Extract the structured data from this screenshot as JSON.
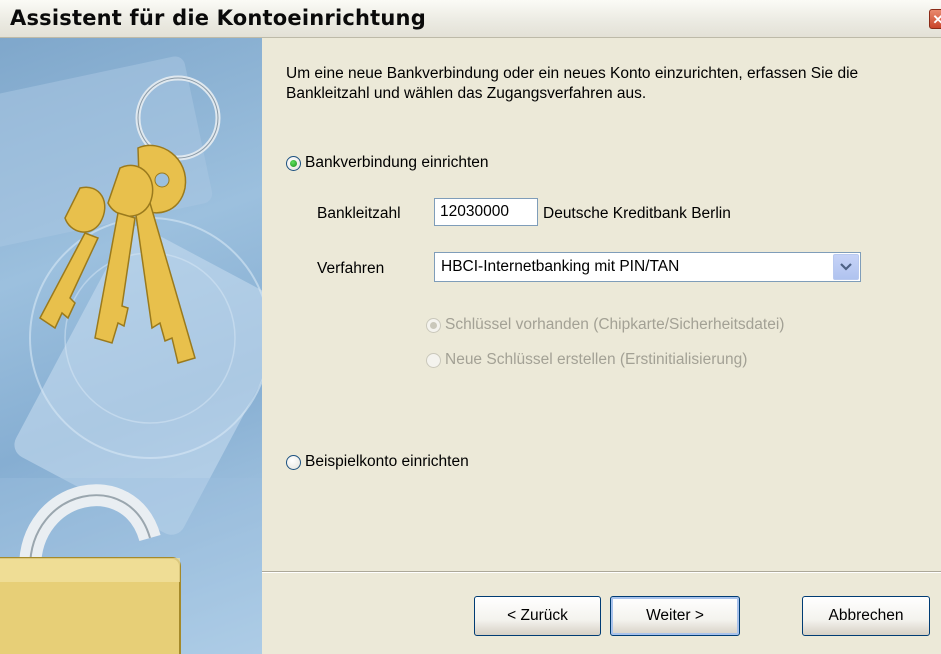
{
  "window": {
    "title": "Assistent für die Kontoeinrichtung",
    "close_glyph": "✕"
  },
  "intro_text": "Um eine neue Bankverbindung oder ein neues Konto einzurichten, erfassen Sie die Bankleitzahl und wählen das Zugangsverfahren aus.",
  "option_bank": {
    "label": "Bankverbindung einrichten",
    "checked": true
  },
  "bank_code": {
    "label": "Bankleitzahl",
    "value": "12030000",
    "bank_name": "Deutsche Kreditbank Berlin"
  },
  "procedure": {
    "label": "Verfahren",
    "selected": "HBCI-Internetbanking mit PIN/TAN"
  },
  "key_options": [
    {
      "label": "Schlüssel vorhanden (Chipkarte/Sicherheitsdatei)",
      "checked": true,
      "enabled": false
    },
    {
      "label": "Neue Schlüssel erstellen (Erstinitialisierung)",
      "checked": false,
      "enabled": false
    }
  ],
  "option_sample": {
    "label": "Beispielkonto einrichten",
    "checked": false
  },
  "buttons": {
    "back": "< Zurück",
    "next": "Weiter >",
    "cancel": "Abbrechen"
  },
  "colors": {
    "dialog_bg": "#ece9d8",
    "border_blue": "#003c74",
    "radio_green": "#1e8f1e"
  },
  "icons": {
    "close": "close-icon",
    "dropdown": "chevron-down-icon",
    "art": "keys-padlock-illustration"
  }
}
